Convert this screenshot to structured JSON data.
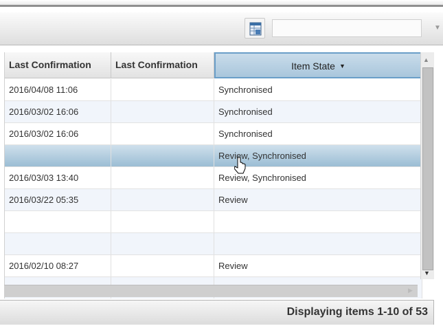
{
  "toolbar": {
    "export_icon": "spreadsheet-export-icon",
    "filter_value": ""
  },
  "grid": {
    "columns": [
      {
        "label": "Last Confirmation"
      },
      {
        "label": "Last Confirmation"
      },
      {
        "label": "Item State",
        "sort": "descending"
      }
    ],
    "rows": [
      {
        "c1": "2016/04/08 11:06",
        "c2": "",
        "c3": "Synchronised"
      },
      {
        "c1": "2016/03/02 16:06",
        "c2": "",
        "c3": "Synchronised"
      },
      {
        "c1": "2016/03/02 16:06",
        "c2": "",
        "c3": "Synchronised"
      },
      {
        "c1": "",
        "c2": "",
        "c3": "Review, Synchronised",
        "selected": true
      },
      {
        "c1": "2016/03/03 13:40",
        "c2": "",
        "c3": "Review, Synchronised"
      },
      {
        "c1": "2016/03/22 05:35",
        "c2": "",
        "c3": "Review"
      },
      {
        "c1": "",
        "c2": "",
        "c3": ""
      },
      {
        "c1": "",
        "c2": "",
        "c3": ""
      },
      {
        "c1": "2016/02/10 08:27",
        "c2": "",
        "c3": "Review"
      },
      {
        "c1": "",
        "c2": "",
        "c3": ""
      }
    ]
  },
  "pager": {
    "text": "Displaying items 1-10 of 53"
  },
  "colors": {
    "header_selected": "#a9c6dc",
    "row_selected": "#9bbdd4",
    "row_alt": "#f1f5fb"
  }
}
